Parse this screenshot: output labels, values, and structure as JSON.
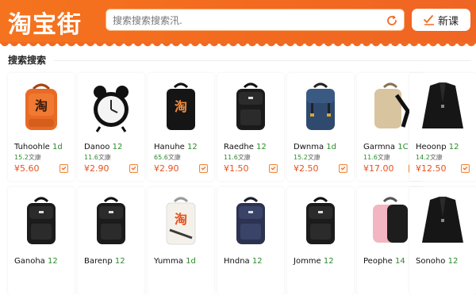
{
  "app": {
    "logo_text": "淘宝街"
  },
  "search": {
    "placeholder": "搜索搜索搜索汛.",
    "button_icon": "refresh-search-icon"
  },
  "header": {
    "new_button_label": "新课",
    "new_button_icon": "check-pen-icon"
  },
  "section": {
    "title": "搜索搜索"
  },
  "colors": {
    "brand": "#f26a1f",
    "price": "#e8511c",
    "accent_number": "#2a8a2a"
  },
  "products_row1": [
    {
      "name": "Tuhoohle",
      "name_num": "1d",
      "sub": "15.2",
      "sub_unit": "文康",
      "price": "¥5.60",
      "icon": "orange-backpack-icon"
    },
    {
      "name": "Danoo",
      "name_num": "12",
      "sub": "11.6",
      "sub_unit": "文康",
      "price": "¥2.90",
      "icon": "alarm-clock-icon"
    },
    {
      "name": "Hanuhe",
      "name_num": "12",
      "sub": "65.6",
      "sub_unit": "文康",
      "price": "¥2.90",
      "icon": "black-bag-icon"
    },
    {
      "name": "Raedhe",
      "name_num": "12",
      "sub": "11.6",
      "sub_unit": "文康",
      "price": "¥1.50",
      "icon": "black-backpack-icon"
    },
    {
      "name": "Dwnma",
      "name_num": "1d",
      "sub": "15.2",
      "sub_unit": "文康",
      "price": "¥2.50",
      "icon": "blue-backpack-icon"
    },
    {
      "name": "Garmna",
      "name_num": "1C",
      "sub": "11.6",
      "sub_unit": "文康",
      "price": "¥17.00",
      "icon": "beige-backpack-icon"
    },
    {
      "name": "Heoonp",
      "name_num": "12",
      "sub": "14.2",
      "sub_unit": "文康",
      "price": "¥12.50",
      "icon": "black-blazer-icon"
    }
  ],
  "products_row2": [
    {
      "name": "Ganoha",
      "name_num": "12",
      "icon": "black-backpack-icon"
    },
    {
      "name": "Barenp",
      "name_num": "12",
      "icon": "black-backpack-icon"
    },
    {
      "name": "Yumma",
      "name_num": "1d",
      "icon": "white-bag-icon"
    },
    {
      "name": "Hndna",
      "name_num": "12",
      "icon": "navy-backpack-icon"
    },
    {
      "name": "Jomme",
      "name_num": "12",
      "icon": "black-backpack-icon"
    },
    {
      "name": "Peophe",
      "name_num": "14",
      "icon": "pink-backpack-icon"
    },
    {
      "name": "Sonoho",
      "name_num": "12",
      "icon": "black-blazer-icon"
    }
  ]
}
